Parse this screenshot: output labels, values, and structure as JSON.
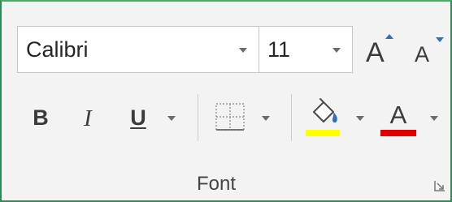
{
  "font_group": {
    "font_name": "Calibri",
    "font_size": "11",
    "grow_font_label": "A",
    "shrink_font_label": "A",
    "bold_label": "B",
    "italic_label": "I",
    "underline_label": "U",
    "font_color_label": "A",
    "group_label": "Font"
  },
  "colors": {
    "highlight_swatch": "#ffff00",
    "font_color_swatch": "#e00000",
    "arrow_accent": "#2b6fbd",
    "panel_border": "#2e8b57"
  },
  "icons": {
    "borders": "borders-icon",
    "fill": "paint-bucket-icon",
    "launcher": "dialog-launcher-icon"
  }
}
